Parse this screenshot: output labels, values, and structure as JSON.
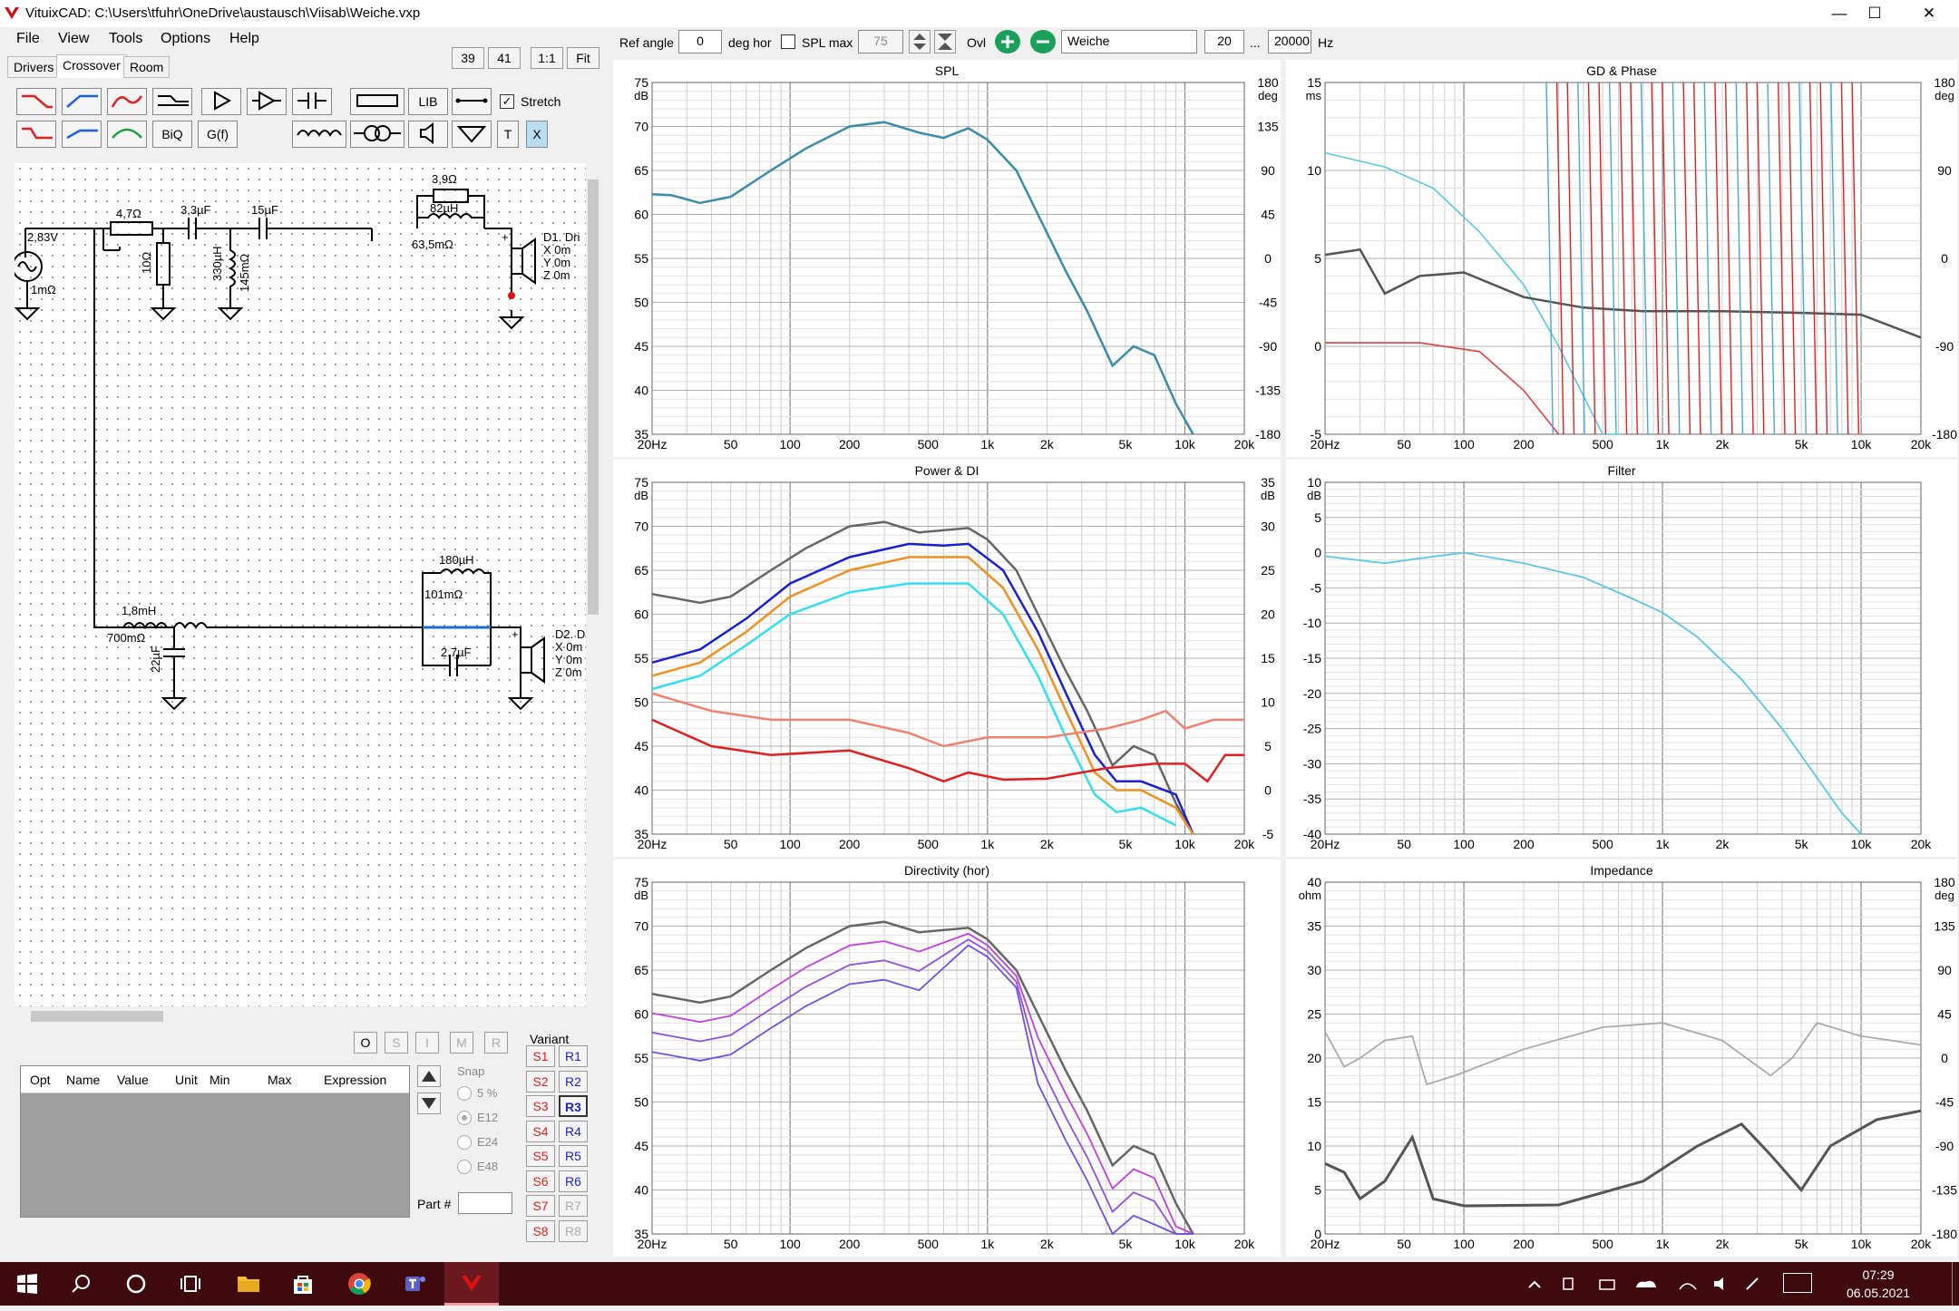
{
  "window": {
    "title": "VituixCAD: C:\\Users\\tfuhr\\OneDrive\\austausch\\Viisab\\Weiche.vxp",
    "minimize": "—",
    "maximize": "☐",
    "close": "✕"
  },
  "menu": [
    "File",
    "View",
    "Tools",
    "Options",
    "Help"
  ],
  "tabs": [
    "Drivers",
    "Crossover",
    "Room"
  ],
  "view_buttons": [
    "39",
    "41",
    "1:1",
    "Fit"
  ],
  "toolbox": {
    "biq": "BiQ",
    "gf": "G(f)",
    "lib": "LIB",
    "stretch_label": "Stretch",
    "stretch_checked": true,
    "t": "T",
    "x": "X"
  },
  "schematic": {
    "source": "2,83V",
    "source_res": "1mΩ",
    "r1": "4,7Ω",
    "c1": "3,3µF",
    "c2": "15µF",
    "r_shunt": "10Ω",
    "l_shunt": "330µH",
    "l_shunt_r": "145mΩ",
    "r_par": "3,9Ω",
    "l_par": "82µH",
    "l_par_r": "63,5mΩ",
    "driver1": [
      "D1. Dri",
      "X 0m",
      "Y 0m",
      "Z 0m"
    ],
    "l_low": "1,8mH",
    "l_low_r": "700mΩ",
    "c_low": "22µF",
    "l_notch": "180µH",
    "l_notch_r": "101mΩ",
    "c_notch": "2,7µF",
    "driver2": [
      "D2. D",
      "X 0m",
      "Y 0m",
      "Z 0m"
    ]
  },
  "opt_buttons": [
    "O",
    "S",
    "I",
    "M",
    "R"
  ],
  "opt_table": {
    "columns": [
      "Opt",
      "Name",
      "Value",
      "Unit",
      "Min",
      "Max",
      "Expression"
    ]
  },
  "snap": {
    "label": "Snap",
    "options": [
      "5 %",
      "E12",
      "E24",
      "E48"
    ],
    "selected": "E12"
  },
  "part_label": "Part #",
  "variant": {
    "label": "Variant",
    "s": [
      "S1",
      "S2",
      "S3",
      "S4",
      "S5",
      "S6",
      "S7",
      "S8"
    ],
    "r": [
      "R1",
      "R2",
      "R3",
      "R4",
      "R5",
      "R6",
      "R7",
      "R8"
    ],
    "active_r": "R3"
  },
  "top_controls": {
    "ref_angle_label": "Ref angle",
    "ref_angle": "0",
    "deg_hor": "deg hor",
    "spl_max_label": "SPL max",
    "spl_max": "75",
    "ovl": "Ovl",
    "name": "Weiche",
    "f_low": "20",
    "dots": "...",
    "f_high": "20000",
    "hz": "Hz"
  },
  "x_ticks": [
    "20Hz",
    "50",
    "100",
    "200",
    "500",
    "1k",
    "2k",
    "5k",
    "10k",
    "20k"
  ],
  "charts": {
    "spl": {
      "title": "SPL",
      "yunit": "dB",
      "y2unit": "deg",
      "yticks": [
        "75",
        "70",
        "65",
        "60",
        "55",
        "50",
        "45",
        "40",
        "35"
      ],
      "y2ticks": [
        "180",
        "135",
        "90",
        "45",
        "0",
        "-45",
        "-90",
        "-135",
        "-180"
      ]
    },
    "gd": {
      "title": "GD & Phase",
      "yunit": "ms",
      "y2unit": "deg",
      "yticks": [
        "15",
        "10",
        "5",
        "0",
        "-5"
      ],
      "y2ticks": [
        "180",
        "90",
        "0",
        "-90",
        "-180"
      ]
    },
    "power": {
      "title": "Power & DI",
      "yunit": "dB",
      "y2unit": "dB",
      "yticks": [
        "75",
        "70",
        "65",
        "60",
        "55",
        "50",
        "45",
        "40",
        "35"
      ],
      "y2ticks": [
        "35",
        "30",
        "25",
        "20",
        "15",
        "10",
        "5",
        "0",
        "-5"
      ]
    },
    "filter": {
      "title": "Filter",
      "yunit": "dB",
      "yticks": [
        "10",
        "5",
        "0",
        "-5",
        "-10",
        "-15",
        "-20",
        "-25",
        "-30",
        "-35",
        "-40"
      ]
    },
    "dir": {
      "title": "Directivity (hor)",
      "yunit": "dB",
      "yticks": [
        "75",
        "70",
        "65",
        "60",
        "55",
        "50",
        "45",
        "40",
        "35"
      ]
    },
    "imp": {
      "title": "Impedance",
      "yunit": "ohm",
      "y2unit": "deg",
      "yticks": [
        "40",
        "35",
        "30",
        "25",
        "20",
        "15",
        "10",
        "5",
        "0"
      ],
      "y2ticks": [
        "180",
        "135",
        "90",
        "45",
        "0",
        "-45",
        "-90",
        "-135",
        "-180"
      ]
    }
  },
  "taskbar": {
    "time": "07:29",
    "date": "06.05.2021"
  }
}
